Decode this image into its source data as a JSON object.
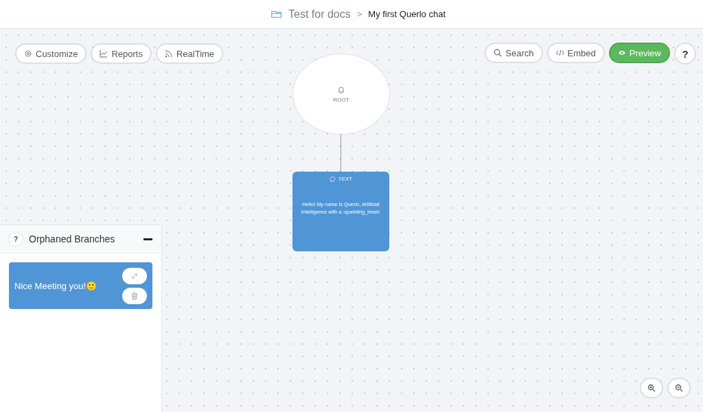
{
  "breadcrumb": {
    "folder": "Test for docs",
    "separator": ">",
    "current": "My first Querlo chat"
  },
  "toolbar_left": [
    {
      "label": "Customize",
      "kind": "gear"
    },
    {
      "label": "Reports",
      "kind": "chart"
    },
    {
      "label": "RealTime",
      "kind": "feed"
    }
  ],
  "toolbar_right": [
    {
      "label": "Search",
      "kind": "search",
      "selected": false
    },
    {
      "label": "Embed",
      "kind": "code",
      "selected": false
    },
    {
      "label": "Preview",
      "kind": "eye",
      "selected": true
    },
    {
      "label": "?",
      "kind": "help",
      "selected": false
    }
  ],
  "root_node": {
    "label": "ROOT"
  },
  "text_node": {
    "type_label": "TEXT",
    "message": "Hello! My name is Querlo, Artificial Intelligence with a :sparkling_heart:"
  },
  "orphaned_panel": {
    "help": "?",
    "title": "Orphaned Branches",
    "expanded": true,
    "items": [
      {
        "text": "Nice Meeting you!🙂"
      }
    ]
  }
}
